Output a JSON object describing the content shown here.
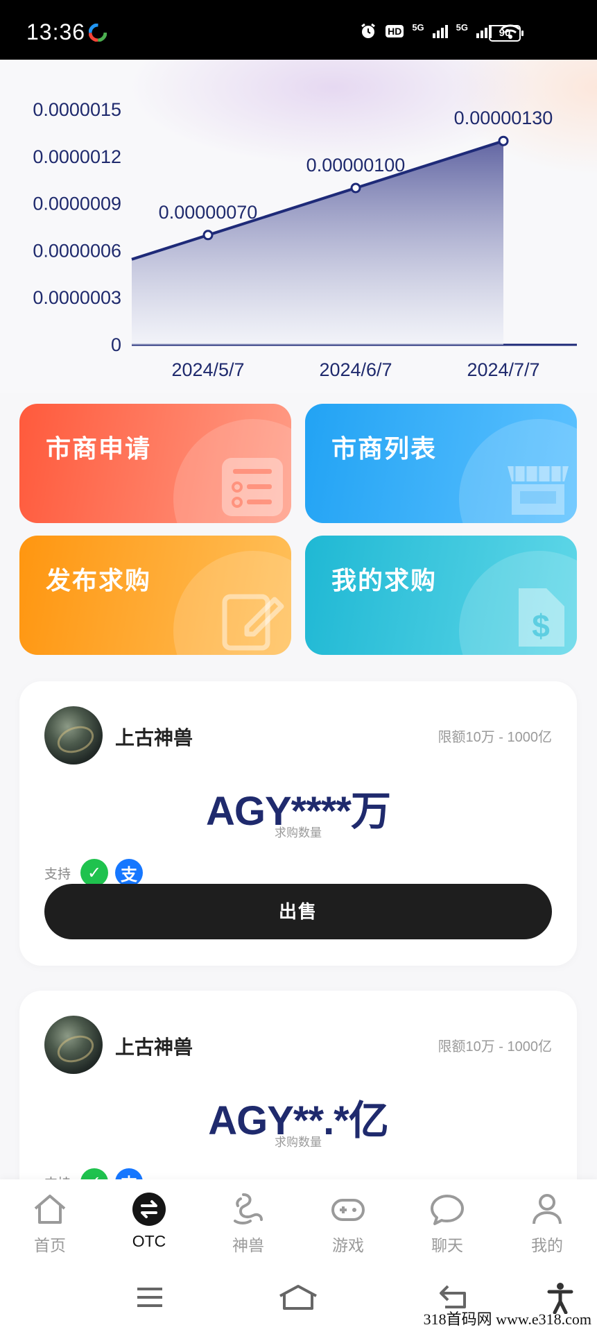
{
  "status_bar": {
    "time": "13:36",
    "battery": "90",
    "network": "5G",
    "hd_label": "HD"
  },
  "chart_data": {
    "type": "area",
    "x": [
      "2024/5/7",
      "2024/6/7",
      "2024/7/7"
    ],
    "series": [
      {
        "values": [
          7e-07,
          1e-06,
          1.3e-06
        ]
      }
    ],
    "data_labels": [
      "0.00000070",
      "0.00000100",
      "0.00000130"
    ],
    "y_ticks": [
      "0",
      "0.0000003",
      "0.0000006",
      "0.0000009",
      "0.0000012",
      "0.0000015"
    ],
    "ylim": [
      0,
      1.5e-06
    ],
    "grid": false,
    "colors": {
      "line": "#1e2a78",
      "fill_top": "#5a5e9e",
      "fill_bottom": "#eef0f8"
    }
  },
  "actions": {
    "apply": "市商申请",
    "list": "市商列表",
    "post": "发布求购",
    "mine": "我的求购"
  },
  "orders": [
    {
      "merchant": "上古神兽",
      "limit": "限额10万 - 1000亿",
      "amount": "AGY****万",
      "amount_label": "求购数量",
      "support_label": "支持",
      "wechat_glyph": "✓",
      "alipay_glyph": "支",
      "sell_label": "出售"
    },
    {
      "merchant": "上古神兽",
      "limit": "限额10万 - 1000亿",
      "amount": "AGY**.*亿",
      "amount_label": "求购数量",
      "support_label": "支持",
      "wechat_glyph": "✓",
      "alipay_glyph": "支"
    }
  ],
  "nav": [
    {
      "label": "首页",
      "icon": "home-icon"
    },
    {
      "label": "OTC",
      "icon": "exchange-icon",
      "active": true
    },
    {
      "label": "神兽",
      "icon": "dragon-icon"
    },
    {
      "label": "游戏",
      "icon": "gamepad-icon"
    },
    {
      "label": "聊天",
      "icon": "chat-icon"
    },
    {
      "label": "我的",
      "icon": "person-icon"
    }
  ],
  "watermark": "318首码网  www.e318.com",
  "colors": {
    "accent_navy": "#1f2a6d",
    "apply": "#ff5a3c",
    "list": "#22a3f4",
    "post": "#ff9610",
    "mine": "#1fb8d4"
  }
}
